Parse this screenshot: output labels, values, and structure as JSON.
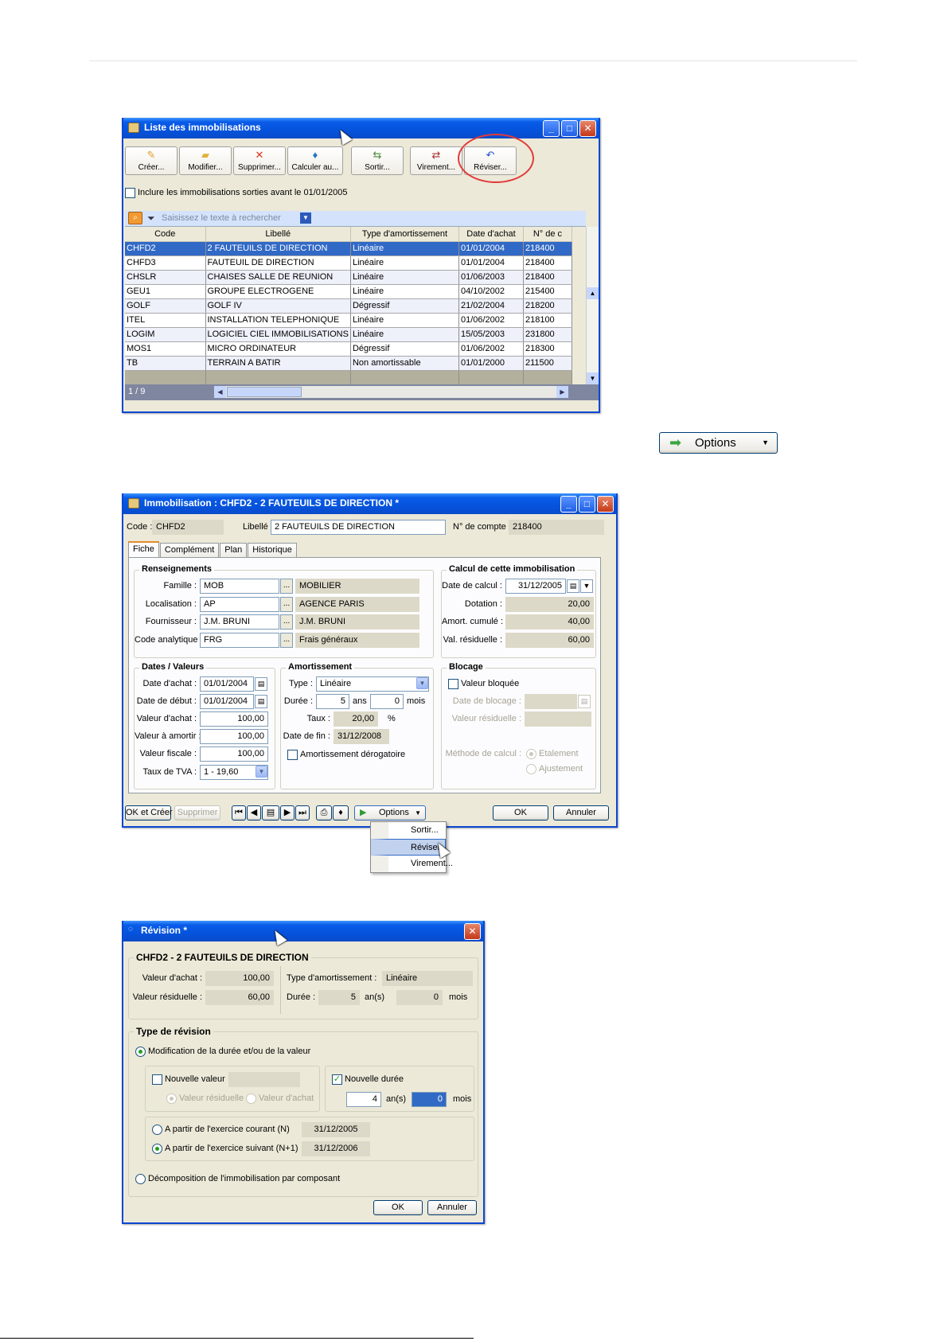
{
  "list_window": {
    "title": "Liste des immobilisations",
    "toolbar": [
      {
        "label": "Créer...",
        "icon": "new-doc-icon"
      },
      {
        "label": "Modifier...",
        "icon": "folder-edit-icon"
      },
      {
        "label": "Supprimer...",
        "icon": "delete-x-icon"
      },
      {
        "label": "Calculer au...",
        "icon": "calculator-icon"
      },
      {
        "label": "Sortir...",
        "icon": "exit-icon"
      },
      {
        "label": "Virement...",
        "icon": "transfer-icon"
      },
      {
        "label": "Réviser...",
        "icon": "undo-arrow-icon"
      }
    ],
    "include_label": "Inclure les immobilisations sorties avant le 01/01/2005",
    "search_placeholder": "Saisissez le texte à rechercher",
    "columns": [
      "Code",
      "Libellé",
      "Type d'amortissement",
      "Date d'achat",
      "N° de c"
    ],
    "rows": [
      [
        "CHFD2",
        "2 FAUTEUILS DE DIRECTION",
        "Linéaire",
        "01/01/2004",
        "218400"
      ],
      [
        "CHFD3",
        "FAUTEUIL DE DIRECTION",
        "Linéaire",
        "01/01/2004",
        "218400"
      ],
      [
        "CHSLR",
        "CHAISES SALLE DE REUNION",
        "Linéaire",
        "01/06/2003",
        "218400"
      ],
      [
        "GEU1",
        "GROUPE ELECTROGENE",
        "Linéaire",
        "04/10/2002",
        "215400"
      ],
      [
        "GOLF",
        "GOLF IV",
        "Dégressif",
        "21/02/2004",
        "218200"
      ],
      [
        "ITEL",
        "INSTALLATION TELEPHONIQUE",
        "Linéaire",
        "01/06/2002",
        "218100"
      ],
      [
        "LOGIM",
        "LOGICIEL CIEL IMMOBILISATIONS",
        "Linéaire",
        "15/05/2003",
        "231800"
      ],
      [
        "MOS1",
        "MICRO ORDINATEUR",
        "Dégressif",
        "01/06/2002",
        "218300"
      ],
      [
        "TB",
        "TERRAIN A BATIR",
        "Non amortissable",
        "01/01/2000",
        "211500"
      ]
    ],
    "status": "1 / 9"
  },
  "options_standalone": {
    "label": "Options"
  },
  "detail_window": {
    "title": "Immobilisation : CHFD2 - 2 FAUTEUILS DE DIRECTION *",
    "code_label": "Code :",
    "code_value": "CHFD2",
    "libelle_label": "Libellé :",
    "libelle_value": "2 FAUTEUILS DE DIRECTION",
    "compte_label": "N° de compte :",
    "compte_value": "218400",
    "tabs": [
      "Fiche",
      "Complément",
      "Plan",
      "Historique"
    ],
    "renseignements": {
      "title": "Renseignements",
      "rows": [
        {
          "label": "Famille :",
          "code": "MOB",
          "name": "MOBILIER"
        },
        {
          "label": "Localisation :",
          "code": "AP",
          "name": "AGENCE PARIS"
        },
        {
          "label": "Fournisseur :",
          "code": "J.M. BRUNI",
          "name": "J.M. BRUNI"
        },
        {
          "label": "Code analytique :",
          "code": "FRG",
          "name": "Frais généraux"
        }
      ]
    },
    "calcul": {
      "title": "Calcul de cette immobilisation",
      "date_label": "Date de calcul :",
      "date_value": "31/12/2005",
      "rows": [
        {
          "label": "Dotation :",
          "value": "20,00"
        },
        {
          "label": "Amort. cumulé :",
          "value": "40,00"
        },
        {
          "label": "Val. résiduelle :",
          "value": "60,00"
        }
      ]
    },
    "dates": {
      "title": "Dates / Valeurs",
      "rows": [
        {
          "label": "Date d'achat :",
          "value": "01/01/2004"
        },
        {
          "label": "Date de début :",
          "value": "01/01/2004"
        },
        {
          "label": "Valeur d'achat :",
          "value": "100,00"
        },
        {
          "label": "Valeur à amortir :",
          "value": "100,00"
        },
        {
          "label": "Valeur fiscale :",
          "value": "100,00"
        },
        {
          "label": "Taux de TVA :",
          "value": "1 - 19,60"
        }
      ]
    },
    "amortissement": {
      "title": "Amortissement",
      "type_label": "Type :",
      "type_value": "Linéaire",
      "duree_label": "Durée :",
      "duree_ans": "5",
      "ans_label": "ans",
      "duree_mois": "0",
      "mois_label": "mois",
      "taux_label": "Taux :",
      "taux_value": "20,00",
      "pct": "%",
      "fin_label": "Date de fin :",
      "fin_value": "31/12/2008",
      "derog_label": "Amortissement dérogatoire"
    },
    "blocage": {
      "title": "Blocage",
      "bloquee_label": "Valeur bloquée",
      "date_label": "Date de blocage :",
      "resid_label": "Valeur résiduelle :",
      "methode_label": "Méthode de calcul :",
      "opt1": "Etalement",
      "opt2": "Ajustement"
    },
    "footer": {
      "ok_creer": "OK et Créer",
      "supprimer": "Supprimer",
      "options": "Options",
      "ok": "OK",
      "annuler": "Annuler"
    },
    "menu": [
      "Sortir...",
      "Réviser...",
      "Virement..."
    ]
  },
  "revision_window": {
    "title": "Révision *",
    "group1_title": "CHFD2 - 2 FAUTEUILS DE DIRECTION",
    "valeur_achat_label": "Valeur d'achat :",
    "valeur_achat": "100,00",
    "valeur_resid_label": "Valeur résiduelle :",
    "valeur_resid": "60,00",
    "type_amort_label": "Type d'amortissement :",
    "type_amort": "Linéaire",
    "duree_label": "Durée :",
    "duree_ans": "5",
    "an_label": "an(s)",
    "duree_mois": "0",
    "mois_label": "mois",
    "group2_title": "Type de révision",
    "modif_label": "Modification de la durée et/ou de la valeur",
    "nouvelle_valeur_label": "Nouvelle valeur",
    "vr_label": "Valeur résiduelle",
    "va_label": "Valeur d'achat",
    "nouvelle_duree_label": "Nouvelle durée",
    "nd_ans": "4",
    "nd_an_label": "an(s)",
    "nd_mois": "0",
    "nd_mois_label": "mois",
    "exercice_courant_label": "A partir de l'exercice courant (N)",
    "exercice_courant_date": "31/12/2005",
    "exercice_suivant_label": "A partir de l'exercice suivant (N+1)",
    "exercice_suivant_date": "31/12/2006",
    "decomp_label": "Décomposition de l'immobilisation par composant",
    "ok": "OK",
    "annuler": "Annuler"
  }
}
